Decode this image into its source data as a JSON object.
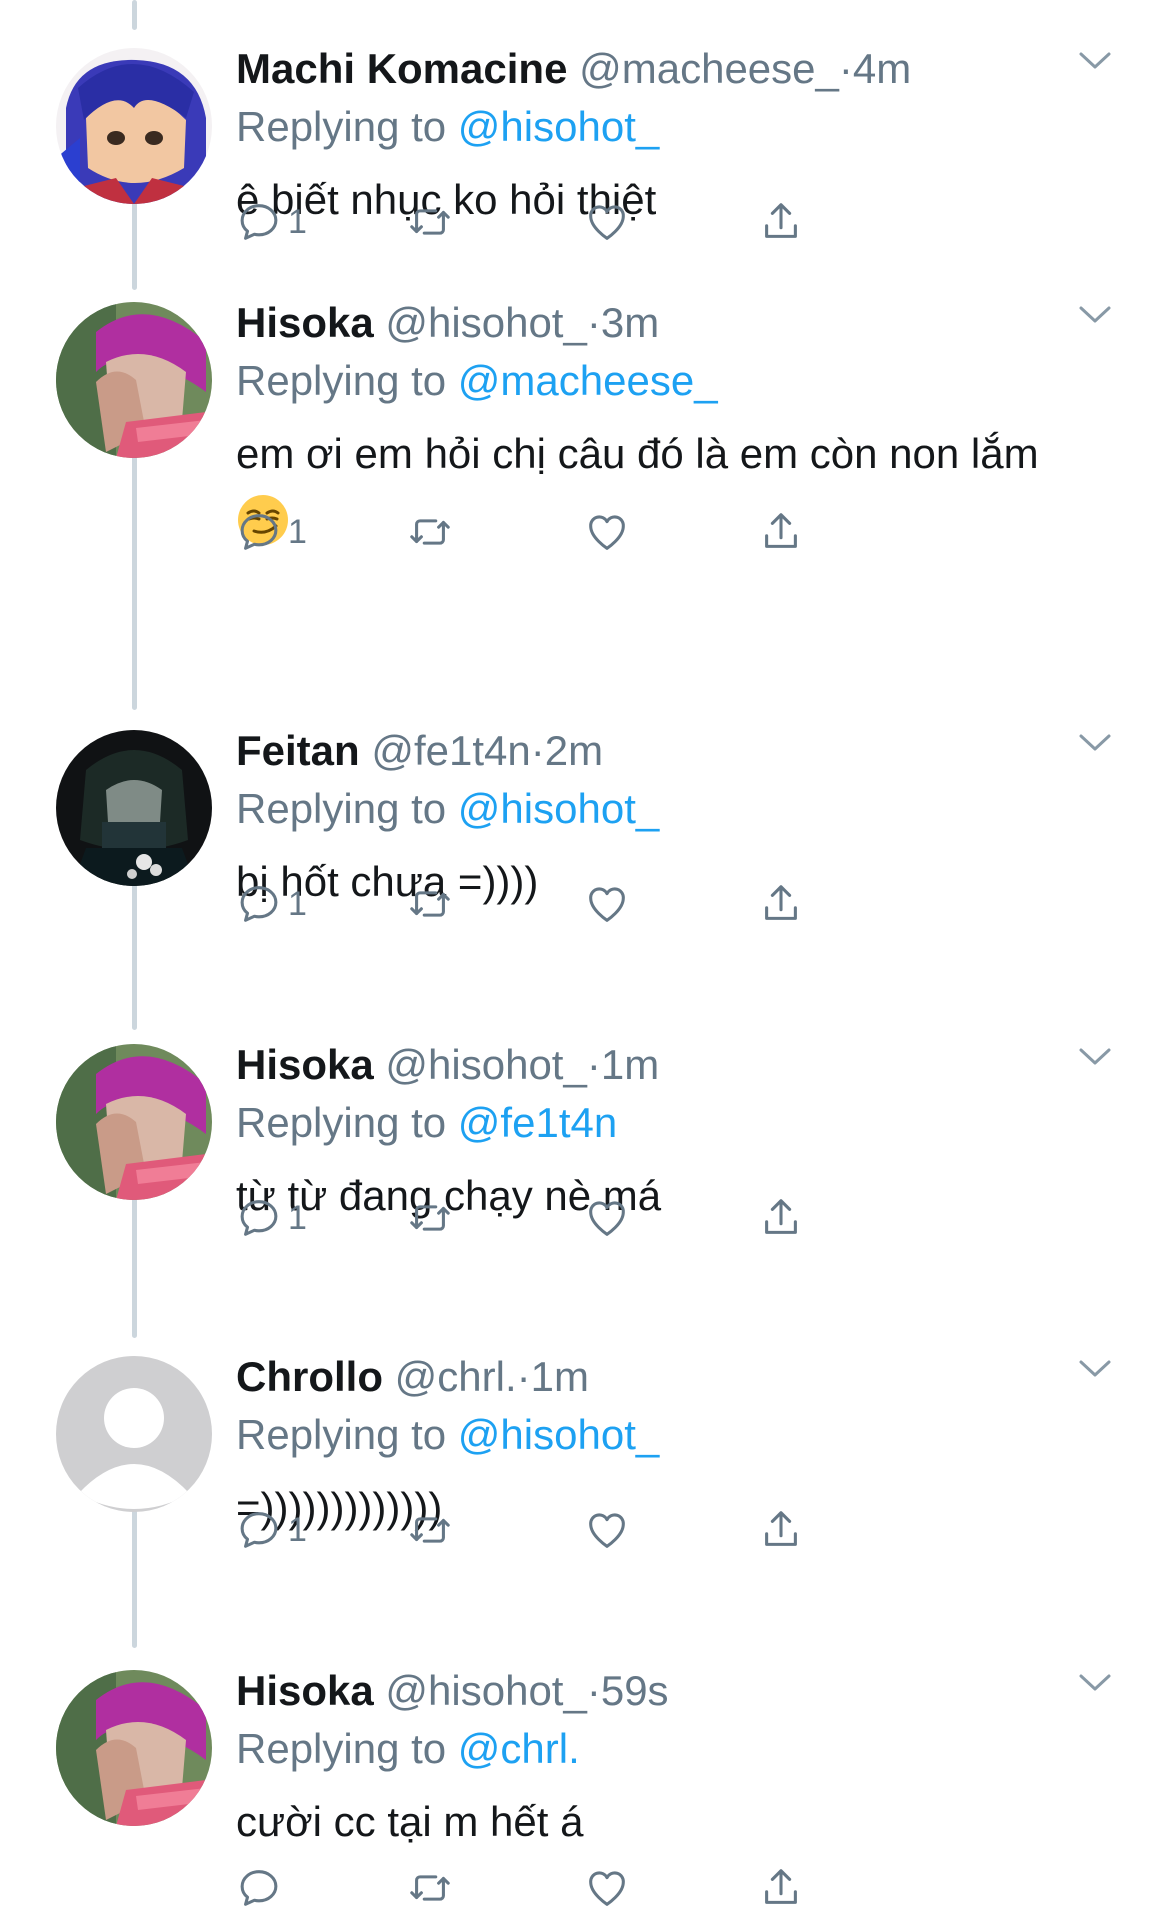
{
  "tweets": [
    {
      "display_name": "Machi Komacine",
      "handle": "@macheese_",
      "time": "4m",
      "replying_label": "Replying to",
      "replying_to": "@hisohot_",
      "text": "ê biết nhục ko hỏi thiệt",
      "reply_count": "1",
      "avatar": "machi"
    },
    {
      "display_name": "Hisoka",
      "handle": "@hisohot_",
      "time": "3m",
      "replying_label": "Replying to",
      "replying_to": "@macheese_",
      "text": "em ơi em hỏi chị câu đó là em còn non lắm",
      "emoji": "smirking-face-emoji",
      "reply_count": "1",
      "avatar": "hisoka"
    },
    {
      "display_name": "Feitan",
      "handle": "@fe1t4n",
      "time": "2m",
      "replying_label": "Replying to",
      "replying_to": "@hisohot_",
      "text": "bị hốt chưa =))))",
      "reply_count": "1",
      "avatar": "feitan"
    },
    {
      "display_name": "Hisoka",
      "handle": "@hisohot_",
      "time": "1m",
      "replying_label": "Replying to",
      "replying_to": "@fe1t4n",
      "text": "từ từ đang chạy nè má",
      "reply_count": "1",
      "avatar": "hisoka"
    },
    {
      "display_name": "Chrollo",
      "handle": "@chrl.",
      "time": "1m",
      "replying_label": "Replying to",
      "replying_to": "@hisohot_",
      "text": "=)))))))))))))",
      "reply_count": "1",
      "avatar": "default"
    },
    {
      "display_name": "Hisoka",
      "handle": "@hisohot_",
      "time": "59s",
      "replying_label": "Replying to",
      "replying_to": "@chrl.",
      "text": "cười cc tại m hết á",
      "reply_count": "",
      "avatar": "hisoka"
    }
  ],
  "separator": "·",
  "icons": {
    "reply": "reply-icon",
    "retweet": "retweet-icon",
    "like": "heart-icon",
    "share": "share-icon",
    "caret": "chevron-down-icon"
  },
  "colors": {
    "text": "#14171a",
    "secondary": "#657786",
    "link": "#1da1f2",
    "thread_line": "#ccd6dd"
  }
}
